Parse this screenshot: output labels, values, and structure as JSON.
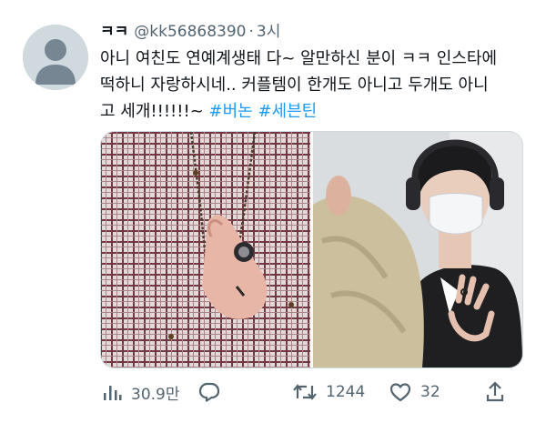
{
  "tweet": {
    "display_name": "ㅋㅋ",
    "handle": "@kk56868390",
    "separator": "·",
    "time": "3시",
    "text_lines": [
      "아니 여친도 연예계생태 다~ 알만하신 분이 ㅋㅋ 인스타에",
      "떡하니 자랑하시네.. 커플템이 한개도 아니고 두개도 아니",
      "고 세개!!!!!!~"
    ],
    "hashtags": [
      "#버논",
      "#세븐틴"
    ]
  },
  "media": {
    "photos": [
      {
        "subject": "checkered-shirt-ring-photo"
      },
      {
        "subject": "masked-man-headphones-photo"
      }
    ]
  },
  "actions": {
    "views": "30.9만",
    "reply": "",
    "retweets": "1244",
    "likes": "32",
    "share": ""
  },
  "colors": {
    "text": "#0f1419",
    "secondary": "#536471",
    "accent": "#1d9bf0",
    "border": "#cfd9de"
  },
  "icons": [
    "default-avatar-icon",
    "views-icon",
    "reply-icon",
    "retweet-icon",
    "like-icon",
    "share-icon"
  ]
}
